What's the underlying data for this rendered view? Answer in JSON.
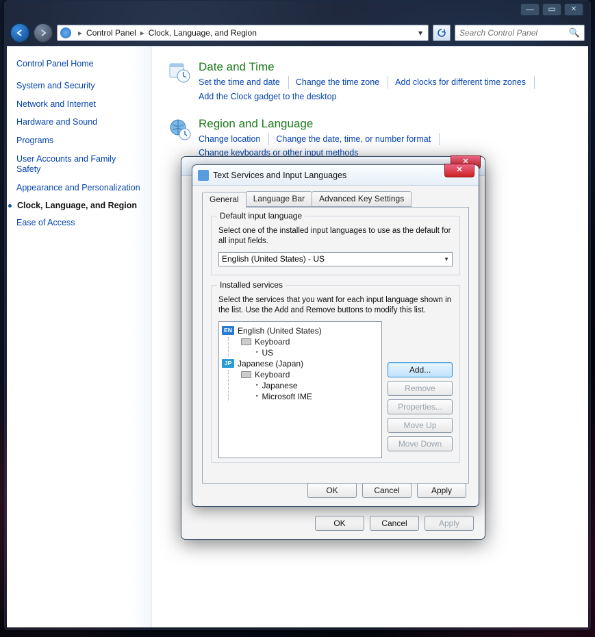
{
  "window": {
    "min_glyph": "—",
    "max_glyph": "▭",
    "close_glyph": "✕"
  },
  "addr": {
    "crumb1": "Control Panel",
    "crumb2": "Clock, Language, and Region",
    "search_placeholder": "Search Control Panel"
  },
  "sidebar": {
    "home": "Control Panel Home",
    "items": [
      "System and Security",
      "Network and Internet",
      "Hardware and Sound",
      "Programs",
      "User Accounts and Family Safety",
      "Appearance and Personalization",
      "Clock, Language, and Region",
      "Ease of Access"
    ],
    "current_index": 6
  },
  "categories": {
    "dt": {
      "title": "Date and Time",
      "links": [
        "Set the time and date",
        "Change the time zone",
        "Add clocks for different time zones",
        "Add the Clock gadget to the desktop"
      ]
    },
    "rl": {
      "title": "Region and Language",
      "links": [
        "Change location",
        "Change the date, time, or number format",
        "Change keyboards or other input methods"
      ]
    }
  },
  "outerdlg": {
    "buttons": {
      "ok": "OK",
      "cancel": "Cancel",
      "apply": "Apply"
    }
  },
  "dlg": {
    "title": "Text Services and Input Languages",
    "tabs": {
      "general": "General",
      "langbar": "Language Bar",
      "adv": "Advanced Key Settings"
    },
    "default_group": {
      "legend": "Default input language",
      "desc": "Select one of the installed input languages to use as the default for all input fields.",
      "value": "English (United States) - US"
    },
    "services_group": {
      "legend": "Installed services",
      "desc": "Select the services that you want for each input language shown in the list. Use the Add and Remove buttons to modify this list.",
      "en": {
        "name": "English (United States)",
        "kbd": "Keyboard",
        "layouts": [
          "US"
        ]
      },
      "jp": {
        "name": "Japanese (Japan)",
        "kbd": "Keyboard",
        "layouts": [
          "Japanese",
          "Microsoft IME"
        ]
      },
      "buttons": {
        "add": "Add...",
        "remove": "Remove",
        "props": "Properties...",
        "up": "Move Up",
        "down": "Move Down"
      }
    },
    "buttons": {
      "ok": "OK",
      "cancel": "Cancel",
      "apply": "Apply"
    }
  }
}
